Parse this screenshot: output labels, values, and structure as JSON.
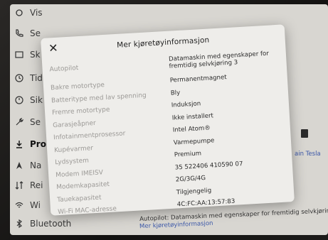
{
  "sidebar": {
    "items": [
      {
        "label": "Vis",
        "icon": "display-icon"
      },
      {
        "label": "Se",
        "icon": "phone-icon"
      },
      {
        "label": "Sk",
        "icon": "screen-icon"
      },
      {
        "label": "Tid",
        "icon": "clock-icon"
      },
      {
        "label": "Sik",
        "icon": "shield-clock-icon"
      },
      {
        "label": "Se",
        "icon": "wrench-icon"
      },
      {
        "label": "Pro",
        "icon": "download-icon"
      },
      {
        "label": "Na",
        "icon": "navigation-icon"
      },
      {
        "label": "Rei",
        "icon": "sort-icon"
      },
      {
        "label": "Wi",
        "icon": "wifi-icon"
      },
      {
        "label": "Bluetooth",
        "icon": "bluetooth-icon"
      }
    ]
  },
  "background": {
    "right_link": "ain Tesla",
    "bottom_line1": "Autopilot: Datamaskin med egenskaper for fremtidig selvkjøring",
    "bottom_link": "Mer kjøretøyinformasjon"
  },
  "modal": {
    "title": "Mer kjøretøyinformasjon",
    "close_symbol": "✕",
    "rows": [
      {
        "label": "Autopilot",
        "value": "Datamaskin med egenskaper for fremtidig selvkjøring 3"
      },
      {
        "label": "Bakre motortype",
        "value": "Permanentmagnet"
      },
      {
        "label": "Batteritype med lav spenning",
        "value": "Bly"
      },
      {
        "label": "Fremre motortype",
        "value": "Induksjon"
      },
      {
        "label": "Garasjeåpner",
        "value": "Ikke installert"
      },
      {
        "label": "Infotainmentprosessor",
        "value": "Intel Atom®"
      },
      {
        "label": "Kupévarmer",
        "value": "Varmepumpe"
      },
      {
        "label": "Lydsystem",
        "value": "Premium"
      },
      {
        "label": "Modem IMEISV",
        "value": "35 522406 410590 07"
      },
      {
        "label": "Modemkapasitet",
        "value": "2G/3G/4G"
      },
      {
        "label": "Tauekapasitet",
        "value": "Tilgjengelig"
      },
      {
        "label": "Wi-Fi MAC-adresse",
        "value": "4C:FC:AA:13:57:83"
      }
    ]
  }
}
